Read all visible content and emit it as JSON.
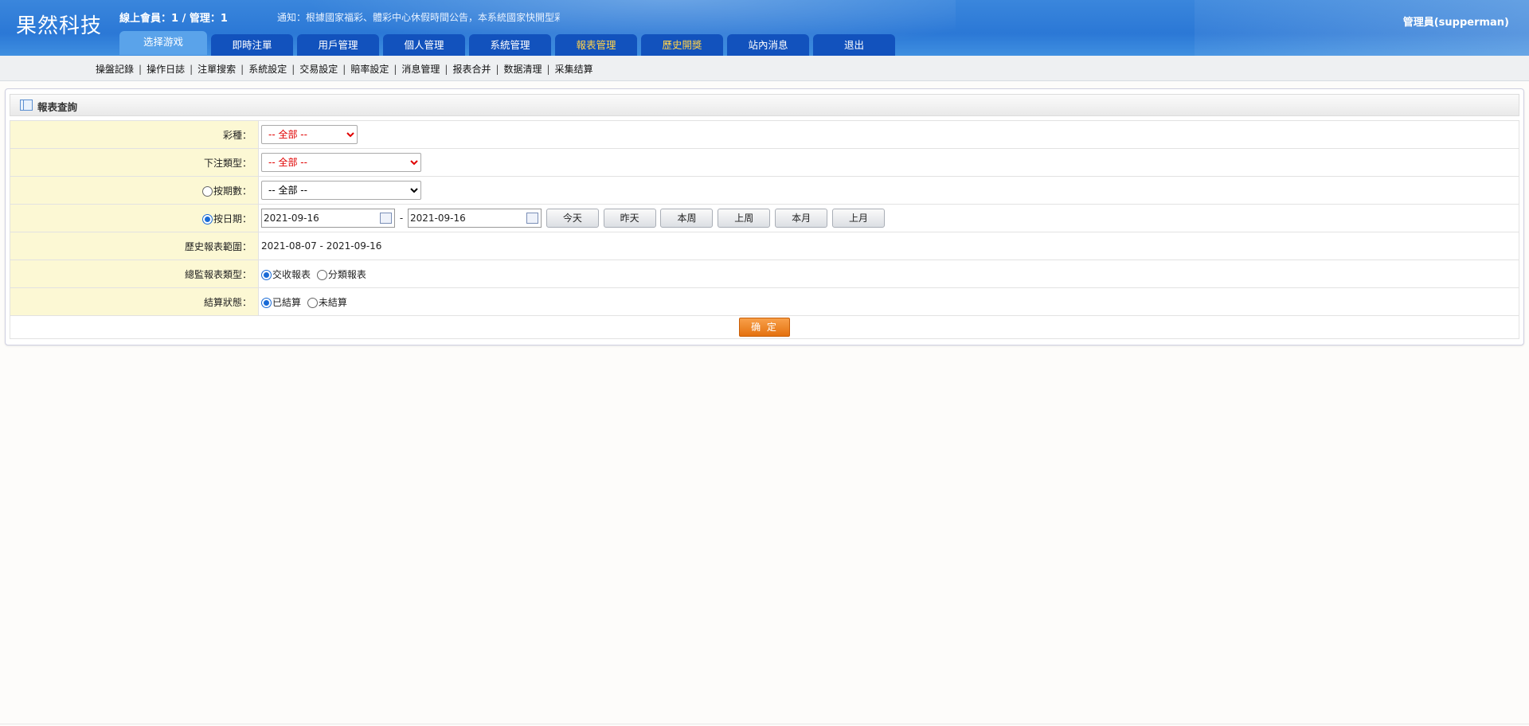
{
  "header": {
    "logo": "果然科技",
    "online": "線上會員：1 / 管理：1",
    "notice": "通知：根據國家福彩、體彩中心休假時間公告，本系統國家快開型彩",
    "admin": "管理員(supperman)"
  },
  "nav": [
    {
      "label": "选择游戏",
      "state": "active"
    },
    {
      "label": "即時注單"
    },
    {
      "label": "用戶管理"
    },
    {
      "label": "個人管理"
    },
    {
      "label": "系統管理"
    },
    {
      "label": "報表管理",
      "highlight": true
    },
    {
      "label": "歷史開獎",
      "highlight": true
    },
    {
      "label": "站內消息"
    },
    {
      "label": "退出"
    }
  ],
  "subnav": [
    "操盤記錄",
    "操作日誌",
    "注單搜索",
    "系統設定",
    "交易設定",
    "賠率設定",
    "消息管理",
    "报表合并",
    "数据清理",
    "采集结算"
  ],
  "panel": {
    "title": "報表查詢",
    "lottery_label": "彩種：",
    "lottery_value": "-- 全部 --",
    "bet_type_label": "下注類型：",
    "bet_type_value": "-- 全部 --",
    "by_period_label": "按期數：",
    "by_period_value": "-- 全部 --",
    "by_date_label": "按日期：",
    "date_from": "2021-09-16",
    "date_sep": "-",
    "date_to": "2021-09-16",
    "quick_buttons": [
      "今天",
      "昨天",
      "本周",
      "上周",
      "本月",
      "上月"
    ],
    "history_label": "歷史報表範圍：",
    "history_value": "2021-08-07 - 2021-09-16",
    "report_type_label": "總監報表類型：",
    "report_type_options": [
      "交收報表",
      "分類報表"
    ],
    "settle_label": "結算狀態：",
    "settle_options": [
      "已結算",
      "未結算"
    ],
    "submit": "确 定"
  },
  "colors": {
    "header_blue": "#2b78d6",
    "tab_blue": "#1252bd",
    "tab_highlight": "#ffd24a",
    "label_bg": "#fcf8d4",
    "submit_orange": "#e4710f"
  }
}
